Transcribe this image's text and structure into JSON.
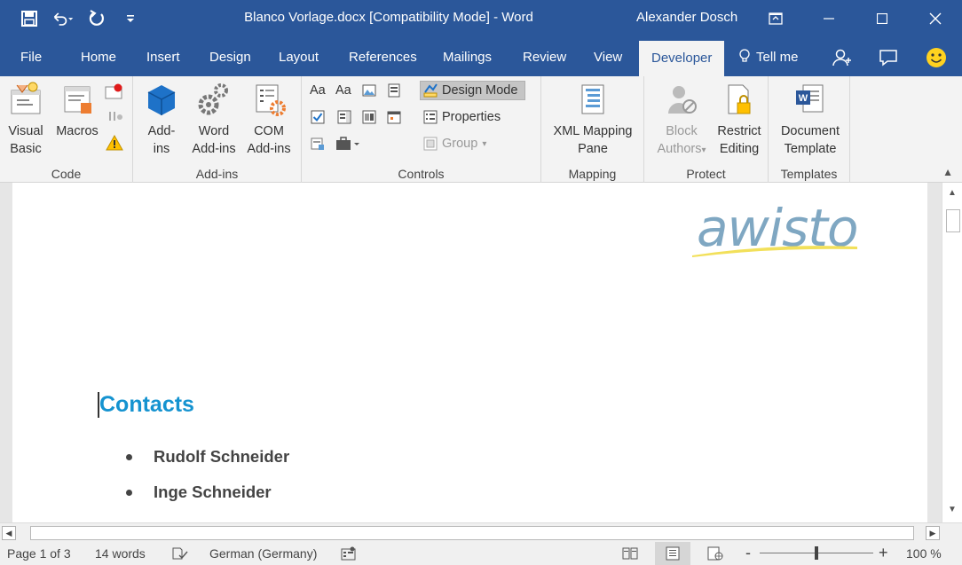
{
  "window": {
    "title": "Blanco Vorlage.docx [Compatibility Mode]  -  Word",
    "user": "Alexander Dosch",
    "qat": {
      "save_icon": "save-icon",
      "undo_icon": "undo-icon",
      "redo_icon": "redo-icon",
      "customize_icon": "customize-qat-icon"
    }
  },
  "tabs": [
    {
      "label": "File"
    },
    {
      "label": "Home"
    },
    {
      "label": "Insert"
    },
    {
      "label": "Design"
    },
    {
      "label": "Layout"
    },
    {
      "label": "References"
    },
    {
      "label": "Mailings"
    },
    {
      "label": "Review"
    },
    {
      "label": "View"
    },
    {
      "label": "Developer"
    }
  ],
  "active_tab": "Developer",
  "tellme": {
    "label": "Tell me"
  },
  "ribbon": {
    "code": {
      "label": "Code",
      "visual_basic": [
        "Visual",
        "Basic"
      ],
      "macros": "Macros"
    },
    "addins": {
      "label": "Add-ins",
      "addins": [
        "Add-",
        "ins"
      ],
      "word_addins": [
        "Word",
        "Add-ins"
      ],
      "com_addins": [
        "COM",
        "Add-ins"
      ]
    },
    "controls": {
      "label": "Controls",
      "aa1": "Aa",
      "aa2": "Aa",
      "design_mode": "Design Mode",
      "properties": "Properties",
      "group": "Group"
    },
    "mapping": {
      "label": "Mapping",
      "xml": [
        "XML Mapping",
        "Pane"
      ]
    },
    "protect": {
      "label": "Protect",
      "block": [
        "Block",
        "Authors"
      ],
      "restrict": [
        "Restrict",
        "Editing"
      ]
    },
    "templates": {
      "label": "Templates",
      "doc_template": [
        "Document",
        "Template"
      ]
    }
  },
  "document": {
    "logo": "awisto",
    "heading": "Contacts",
    "bullets": [
      "Rudolf Schneider",
      "Inge Schneider"
    ]
  },
  "status": {
    "page": "Page 1 of 3",
    "words": "14 words",
    "language": "German (Germany)",
    "zoom": "100 %",
    "zoom_minus": "-",
    "zoom_plus": "+"
  },
  "colors": {
    "accent": "#2b579a",
    "heading": "#1593d0",
    "logo": "#7fa7c2"
  }
}
